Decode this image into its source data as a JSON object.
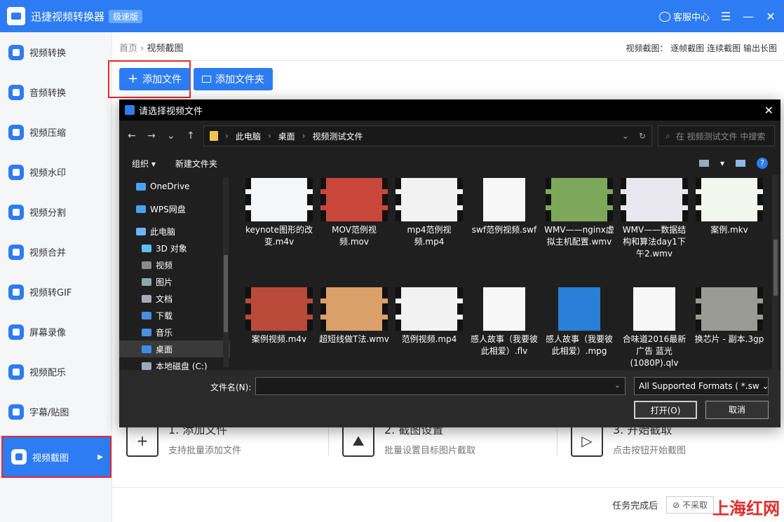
{
  "app": {
    "title": "迅捷视频转换器",
    "edition": "极速版",
    "service": "客服中心",
    "menu_icon": "menu-icon",
    "min_icon": "minimize-icon",
    "close_icon": "close-icon"
  },
  "sidebar": {
    "items": [
      {
        "label": "视频转换"
      },
      {
        "label": "音频转换"
      },
      {
        "label": "视频压缩"
      },
      {
        "label": "视频水印"
      },
      {
        "label": "视频分割"
      },
      {
        "label": "视频合并"
      },
      {
        "label": "视频转GIF"
      },
      {
        "label": "屏幕录像"
      },
      {
        "label": "视频配乐"
      },
      {
        "label": "字幕/贴图"
      },
      {
        "label": "视频截图"
      }
    ],
    "active_index": 10
  },
  "breadcrumb": {
    "home": "首页",
    "sep": "›",
    "current": "视频截图"
  },
  "modes": {
    "label": "视频截图：",
    "frame": "逐帧截图",
    "continuous": "连续截图",
    "long": "输出长图"
  },
  "toolbar": {
    "add_file": "添加文件",
    "add_folder": "添加文件夹"
  },
  "steps": [
    {
      "title": "1. 添加文件",
      "desc": "支持批量添加文件"
    },
    {
      "title": "2. 截图设置",
      "desc": "批量设置目标图片截取"
    },
    {
      "title": "3. 开始截取",
      "desc": "点击按钮开始截图"
    }
  ],
  "footer": {
    "after_task": "任务完成后",
    "option": "不采取"
  },
  "watermark": "上海红网",
  "dialog": {
    "title": "请选择视频文件",
    "path": [
      "此电脑",
      "桌面",
      "视频测试文件"
    ],
    "search_placeholder": "在 视频测试文件 中搜索",
    "organize": "组织 ▾",
    "new_folder": "新建文件夹",
    "tree": [
      {
        "label": "OneDrive",
        "level": 1,
        "color": "#4aa3f0"
      },
      {
        "label": "WPS网盘",
        "level": 1,
        "color": "#4aa3f0"
      },
      {
        "label": "此电脑",
        "level": 1,
        "color": "#6fb3f2"
      },
      {
        "label": "3D 对象",
        "level": 2,
        "color": "#5bc0f0"
      },
      {
        "label": "视频",
        "level": 2,
        "color": "#8a8a8a"
      },
      {
        "label": "图片",
        "level": 2,
        "color": "#8aa"
      },
      {
        "label": "文档",
        "level": 2,
        "color": "#aab"
      },
      {
        "label": "下载",
        "level": 2,
        "color": "#4a8fe0"
      },
      {
        "label": "音乐",
        "level": 2,
        "color": "#4a8fe0"
      },
      {
        "label": "桌面",
        "level": 2,
        "color": "#3a8ee8"
      },
      {
        "label": "本地磁盘 (C:)",
        "level": 2,
        "color": "#9ab"
      }
    ],
    "selected_tree_index": 9,
    "files": [
      {
        "name": "keynote图形的改变.m4v",
        "kind": "film",
        "bg": "#f4f6f8"
      },
      {
        "name": "MOV范例视频.mov",
        "kind": "film",
        "bg": "#c8463a"
      },
      {
        "name": "mp4范例视频.mp4",
        "kind": "film",
        "bg": "#f2f2f2"
      },
      {
        "name": "swf范例视频.swf",
        "kind": "doc",
        "bg": "#f7f7f7"
      },
      {
        "name": "WMV——nginx虚拟主机配置.wmv",
        "kind": "film",
        "bg": "#7da85a"
      },
      {
        "name": "WMV——数据结构和算法day1下午2.wmv",
        "kind": "film",
        "bg": "#e8e8ee"
      },
      {
        "name": "案例.mkv",
        "kind": "film",
        "bg": "#f2f6ee"
      },
      {
        "name": "案例视频.m4v",
        "kind": "film",
        "bg": "#b94a3a"
      },
      {
        "name": "超短线做T法.wmv",
        "kind": "film",
        "bg": "#d9a06a"
      },
      {
        "name": "范例视频.mp4",
        "kind": "film",
        "bg": "#f2f2f2"
      },
      {
        "name": "感人故事（我要彼此相爱）.flv",
        "kind": "doc",
        "bg": "#f7f7f7"
      },
      {
        "name": "感人故事（我要彼此相爱）.mpg",
        "kind": "doc",
        "bg": "#2a7fd6"
      },
      {
        "name": "合味道2016最新广告 蓝光(1080P).qlv",
        "kind": "doc",
        "bg": "#f7f7f7"
      },
      {
        "name": "换芯片 - 副本.3gp",
        "kind": "film",
        "bg": "#9a9a94"
      }
    ],
    "filename_label": "文件名(N):",
    "filename_value": "",
    "format": "All Supported Formats ( *.sw",
    "open": "打开(O)",
    "cancel": "取消"
  }
}
